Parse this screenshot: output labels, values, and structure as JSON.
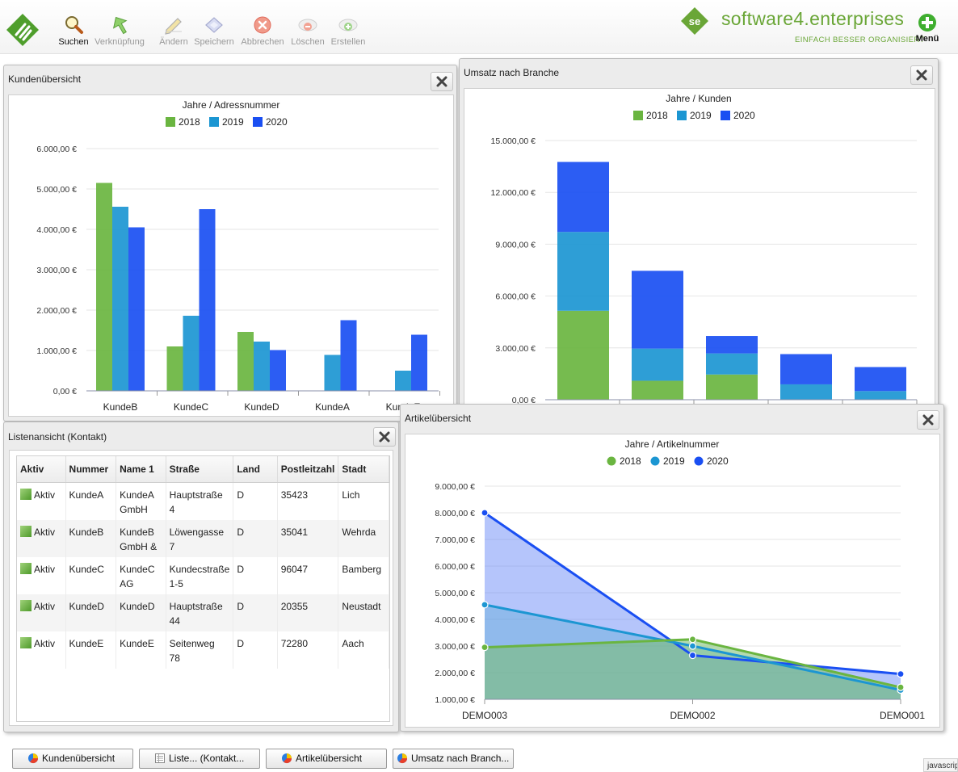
{
  "toolbar": {
    "buttons": [
      {
        "label": "Suchen",
        "icon": "magnifier-icon",
        "enabled": true
      },
      {
        "label": "Verknüpfung",
        "icon": "link-arrow-icon",
        "enabled": false
      },
      {
        "label": "Ändern",
        "icon": "pencil-icon",
        "enabled": false
      },
      {
        "label": "Speichern",
        "icon": "save-diamond-icon",
        "enabled": false
      },
      {
        "label": "Abbrechen",
        "icon": "cancel-icon",
        "enabled": false
      },
      {
        "label": "Löschen",
        "icon": "delete-icon",
        "enabled": false
      },
      {
        "label": "Erstellen",
        "icon": "create-icon",
        "enabled": false
      }
    ],
    "brand_name": "software4.enterprises",
    "brand_slogan": "EINFACH BESSER ORGANISIERT",
    "menu_label": "Menü"
  },
  "colors": {
    "y2018": "#6ab540",
    "y2019": "#1c96d2",
    "y2020": "#1a4ff2",
    "brand": "#6aa637"
  },
  "panels": {
    "kunden": {
      "title": "Kundenübersicht"
    },
    "umsatz": {
      "title": "Umsatz nach Branche"
    },
    "liste": {
      "title": "Listenansicht (Kontakt)"
    },
    "artikel": {
      "title": "Artikelübersicht"
    }
  },
  "chart_data": [
    {
      "id": "kunden",
      "type": "bar",
      "title": "Jahre / Adressnummer",
      "legend": "top-center",
      "categories": [
        "KundeB",
        "KundeC",
        "KundeD",
        "KundeA",
        "KundeE"
      ],
      "series": [
        {
          "name": "2018",
          "values": [
            5150,
            1100,
            1460,
            0,
            0
          ]
        },
        {
          "name": "2019",
          "values": [
            4560,
            1860,
            1220,
            890,
            500
          ]
        },
        {
          "name": "2020",
          "values": [
            4050,
            4500,
            1010,
            1750,
            1390
          ]
        }
      ],
      "ylim": [
        0,
        6000
      ],
      "yticks": [
        0,
        1000,
        2000,
        3000,
        4000,
        5000,
        6000
      ],
      "ytick_labels": [
        "0,00 €",
        "1.000,00 €",
        "2.000,00 €",
        "3.000,00 €",
        "4.000,00 €",
        "5.000,00 €",
        "6.000,00 €"
      ],
      "grid": true
    },
    {
      "id": "umsatz",
      "type": "bar",
      "stacked": true,
      "title": "Jahre / Kunden",
      "legend": "top-center",
      "categories": [
        "",
        "",
        "",
        "",
        ""
      ],
      "series": [
        {
          "name": "2018",
          "values": [
            5150,
            1100,
            1460,
            0,
            0
          ]
        },
        {
          "name": "2019",
          "values": [
            4560,
            1860,
            1220,
            890,
            500
          ]
        },
        {
          "name": "2020",
          "values": [
            4050,
            4500,
            1010,
            1750,
            1390
          ]
        }
      ],
      "ylim": [
        0,
        15000
      ],
      "yticks": [
        0,
        3000,
        6000,
        9000,
        12000,
        15000
      ],
      "ytick_labels": [
        "0,00 €",
        "3.000,00 €",
        "6.000,00 €",
        "9.000,00 €",
        "12.000,00 €",
        "15.000,00 €"
      ],
      "grid": true
    },
    {
      "id": "artikel",
      "type": "area",
      "title": "Jahre / Artikelnummer",
      "legend": "top-center",
      "categories": [
        "DEMO003",
        "DEMO002",
        "DEMO001"
      ],
      "series": [
        {
          "name": "2018",
          "values": [
            2950,
            3250,
            1450
          ]
        },
        {
          "name": "2019",
          "values": [
            4550,
            3000,
            1350
          ]
        },
        {
          "name": "2020",
          "values": [
            8000,
            2650,
            1950
          ]
        }
      ],
      "ylim": [
        1000,
        9000
      ],
      "yticks": [
        1000,
        2000,
        3000,
        4000,
        5000,
        6000,
        7000,
        8000,
        9000
      ],
      "ytick_labels": [
        "1.000,00 €",
        "2.000,00 €",
        "3.000,00 €",
        "4.000,00 €",
        "5.000,00 €",
        "6.000,00 €",
        "7.000,00 €",
        "8.000,00 €",
        "9.000,00 €"
      ],
      "grid": true
    }
  ],
  "list": {
    "columns": [
      "Aktiv",
      "Nummer",
      "Name 1",
      "Straße",
      "Land",
      "Postleitzahl",
      "Stadt"
    ],
    "rows": [
      {
        "aktiv": "Aktiv",
        "nummer": "KundeA",
        "name1": "KundeA\nGmbH",
        "strasse": "Hauptstraße\n4",
        "land": "D",
        "plz": "35423",
        "stadt": "Lich"
      },
      {
        "aktiv": "Aktiv",
        "nummer": "KundeB",
        "name1": "KundeB\nGmbH &",
        "strasse": "Löwengasse\n7",
        "land": "D",
        "plz": "35041",
        "stadt": "Wehrda"
      },
      {
        "aktiv": "Aktiv",
        "nummer": "KundeC",
        "name1": "KundeC\nAG",
        "strasse": "Kundecstraße\n1-5",
        "land": "D",
        "plz": "96047",
        "stadt": "Bamberg"
      },
      {
        "aktiv": "Aktiv",
        "nummer": "KundeD",
        "name1": "KundeD",
        "strasse": "Hauptstraße\n44",
        "land": "D",
        "plz": "20355",
        "stadt": "Neustadt"
      },
      {
        "aktiv": "Aktiv",
        "nummer": "KundeE",
        "name1": "KundeE",
        "strasse": "Seitenweg\n78",
        "land": "D",
        "plz": "72280",
        "stadt": "Aach"
      }
    ]
  },
  "taskbar": [
    {
      "label": "Kundenübersicht",
      "icon": "pie-chart-icon"
    },
    {
      "label": "Liste... (Kontakt...",
      "icon": "list-icon"
    },
    {
      "label": "Artikelübersicht",
      "icon": "pie-chart-icon"
    },
    {
      "label": "Umsatz nach Branch...",
      "icon": "pie-chart-icon"
    }
  ],
  "status_text": "javascript"
}
